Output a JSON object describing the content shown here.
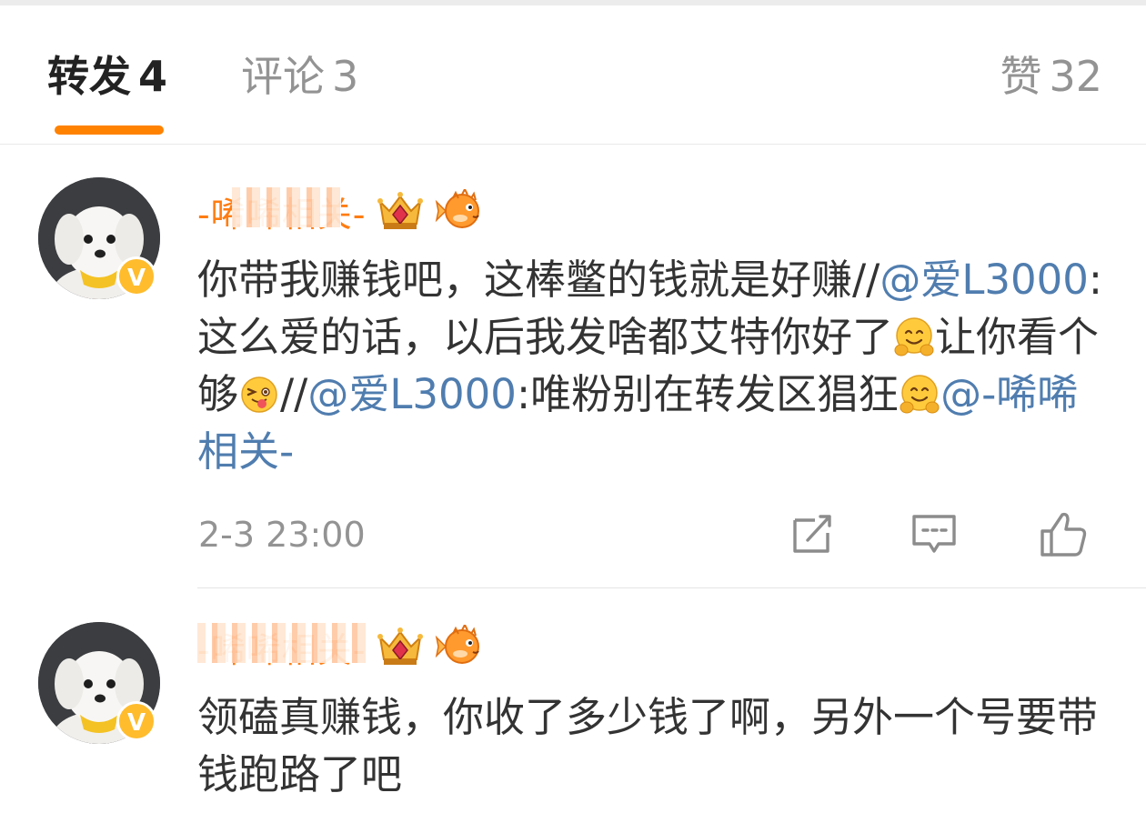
{
  "tabs": {
    "repost": {
      "label": "转发",
      "count": "4"
    },
    "comment": {
      "label": "评论",
      "count": "3"
    },
    "like": {
      "label": "赞",
      "count": "32"
    }
  },
  "accent_color": "#ff8200",
  "mention_color": "#507daf",
  "posts": [
    {
      "username": "-唏唏相关-",
      "content": {
        "t1": "你带我赚钱吧，这棒鳖的钱就是好赚//",
        "m1": "@爱L3000",
        "t2": ":这么爱的话，以后我发啥都艾特你好了",
        "t3": "让你看个够",
        "t4": "//",
        "m2": "@爱L3000",
        "t5": ":唯粉别在转发区猖狂",
        "m3": "@-唏唏相关-"
      },
      "time": "2-3 23:00",
      "icons": [
        "crown-badge-icon",
        "pufferfish-icon",
        "hug-emoji",
        "wink-emoji",
        "repost-icon",
        "comment-icon",
        "like-icon"
      ]
    },
    {
      "username": "-唏唏相关-",
      "content": {
        "t1": "领磕真赚钱，你收了多少钱了啊，另外一个号要带钱跑路了吧"
      }
    }
  ]
}
